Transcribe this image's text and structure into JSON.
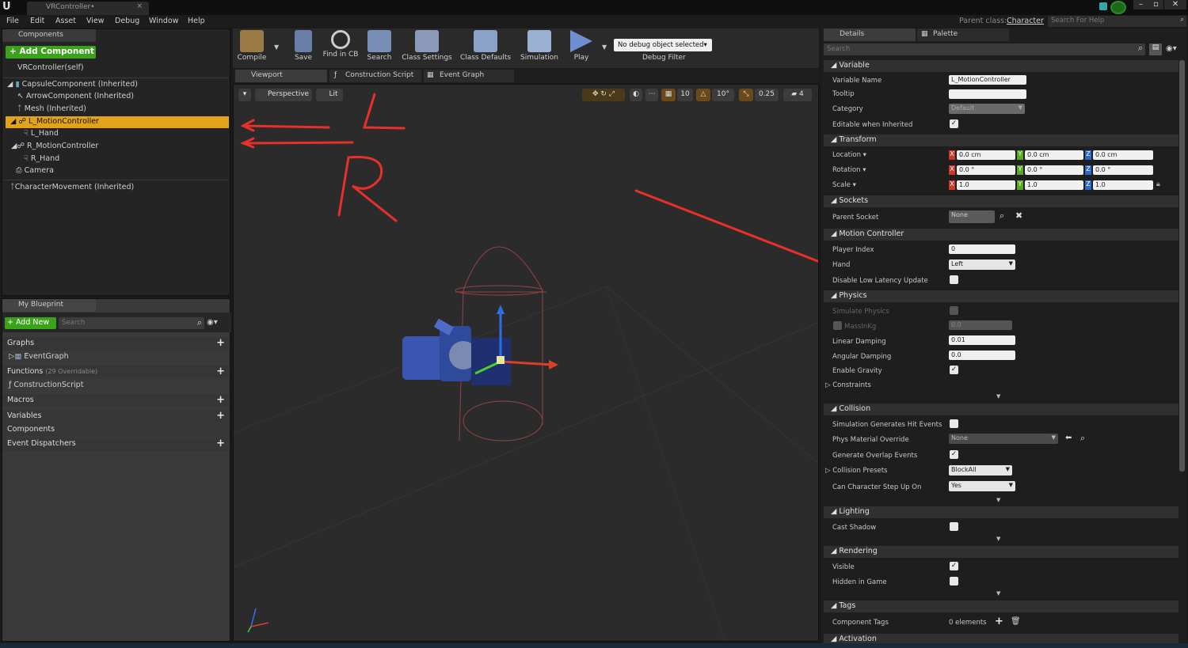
{
  "title_tab": "VRController•",
  "menu": [
    "File",
    "Edit",
    "Asset",
    "View",
    "Debug",
    "Window",
    "Help"
  ],
  "parent_class_label": "Parent class:",
  "parent_class_value": "Character",
  "search_help_placeholder": "Search For Help",
  "components_tab": "Components",
  "add_component": "+ Add Component",
  "root": "VRController(self)",
  "tree": [
    "CapsuleComponent (Inherited)",
    "ArrowComponent (Inherited)",
    "Mesh (Inherited)",
    "L_MotionController",
    "L_Hand",
    "R_MotionController",
    "R_Hand",
    "Camera",
    "CharacterMovement (Inherited)"
  ],
  "toolbar": [
    "Compile",
    "Save",
    "Find in CB",
    "Search",
    "Class Settings",
    "Class Defaults",
    "Simulation",
    "Play"
  ],
  "debug_object": "No debug object selected",
  "debug_filter": "Debug Filter",
  "graph_tabs": [
    "Viewport",
    "Construction Script",
    "Event Graph"
  ],
  "view_mode": "Perspective",
  "lit": "Lit",
  "vp_values": [
    "10",
    "10°",
    "0.25",
    "4"
  ],
  "my_blueprint": "My Blueprint",
  "add_new": "+ Add New",
  "search": "Search",
  "bp": {
    "graphs": "Graphs",
    "event_graph": "EventGraph",
    "functions": "Functions",
    "functions_note": "(29 Overridable)",
    "construction": "ConstructionScript",
    "macros": "Macros",
    "variables": "Variables",
    "components": "Components",
    "dispatchers": "Event Dispatchers"
  },
  "details_tab": "Details",
  "palette_tab": "Palette",
  "details_search": "Search",
  "sections": {
    "variable": "Variable",
    "transform": "Transform",
    "sockets": "Sockets",
    "motion": "Motion Controller",
    "physics": "Physics",
    "collision": "Collision",
    "lighting": "Lighting",
    "rendering": "Rendering",
    "tags": "Tags",
    "activation": "Activation"
  },
  "props": {
    "var_name_l": "Variable Name",
    "var_name_v": "L_MotionController",
    "tooltip": "Tooltip",
    "category_l": "Category",
    "category_v": "Default",
    "editable": "Editable when Inherited",
    "location": "Location ▾",
    "rotation": "Rotation ▾",
    "scale": "Scale ▾",
    "loc": [
      "0.0 cm",
      "0.0 cm",
      "0.0 cm"
    ],
    "rot": [
      "0.0 °",
      "0.0 °",
      "0.0 °"
    ],
    "scl": [
      "1.0",
      "1.0",
      "1.0"
    ],
    "parent_socket": "Parent Socket",
    "none": "None",
    "player_index_l": "Player Index",
    "player_index_v": "0",
    "hand_l": "Hand",
    "hand_v": "Left",
    "low_latency": "Disable Low Latency Update",
    "sim_physics": "Simulate Physics",
    "mass": "MassInKg",
    "mass_v": "0.0",
    "lin_damp_l": "Linear Damping",
    "lin_damp_v": "0.01",
    "ang_damp_l": "Angular Damping",
    "ang_damp_v": "0.0",
    "gravity": "Enable Gravity",
    "constraints": "Constraints",
    "sim_hit": "Simulation Generates Hit Events",
    "phys_mat": "Phys Material Override",
    "phys_mat_v": "None",
    "overlap": "Generate Overlap Events",
    "presets_l": "Collision Presets",
    "presets_v": "BlockAll",
    "step_l": "Can Character Step Up On",
    "step_v": "Yes",
    "cast_shadow": "Cast Shadow",
    "visible": "Visible",
    "hidden": "Hidden in Game",
    "comp_tags": "Component Tags",
    "comp_tags_v": "0 elements"
  },
  "axes": [
    "X",
    "Y",
    "Z"
  ],
  "colors": {
    "accent_green": "#3aa31a",
    "selected": "#e2a21a",
    "annotation": "#e8302a"
  }
}
